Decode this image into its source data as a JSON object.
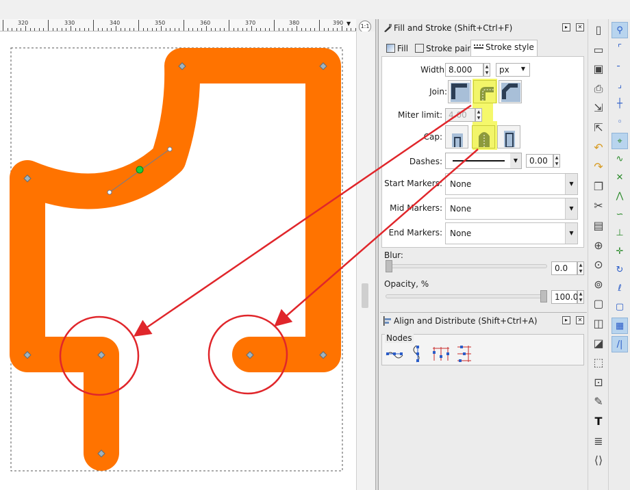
{
  "ruler": {
    "labels": [
      "320",
      "330",
      "340",
      "350",
      "360",
      "370",
      "380",
      "390"
    ],
    "arrow": "▼"
  },
  "zoom_corner": "1:1",
  "dock": {
    "fill_stroke": {
      "title": "Fill and Stroke (Shift+Ctrl+F)",
      "tabs": {
        "fill": "Fill",
        "stroke_paint": "Stroke paint",
        "stroke_style": "Stroke style"
      },
      "width_label": "Width:",
      "width_value": "8.000",
      "unit": "px",
      "join_label": "Join:",
      "join_selected": "round",
      "miter_label": "Miter limit:",
      "miter_value": "4.00",
      "cap_label": "Cap:",
      "cap_selected": "round",
      "dashes_label": "Dashes:",
      "dashes_value": "0.00",
      "start_markers_label": "Start Markers:",
      "mid_markers_label": "Mid Markers:",
      "end_markers_label": "End Markers:",
      "start_markers_value": "None",
      "mid_markers_value": "None",
      "end_markers_value": "None",
      "blur_label": "Blur:",
      "blur_value": "0.0",
      "blur_fraction": 0.0,
      "opacity_label": "Opacity, %",
      "opacity_value": "100.0",
      "opacity_fraction": 1.0
    },
    "align": {
      "title": "Align and Distribute (Shift+Ctrl+A)",
      "nodes_label": "Nodes"
    }
  },
  "colors": {
    "stroke": "#ff7300",
    "annotation": "#e0262b",
    "highlight": "#f5f86b",
    "node": "#9fb3c0",
    "selected_node": "#1fcc3a"
  },
  "command_icons": [
    "new-document-icon",
    "open-icon",
    "save-icon",
    "print-icon",
    "import-icon",
    "export-icon",
    "undo-icon",
    "redo-icon",
    "copy-icon",
    "cut-icon",
    "paste-icon",
    "zoom-selection-icon",
    "zoom-drawing-icon",
    "zoom-page-icon",
    "duplicate-icon",
    "clone-icon",
    "unlink-clone-icon",
    "group-icon",
    "ungroup-icon",
    "fill-stroke-icon",
    "text-icon",
    "layers-icon",
    "xml-editor-icon"
  ],
  "snap_icons": [
    "snap-enable-icon",
    "snap-bbox-icon",
    "snap-bbox-edge-icon",
    "snap-bbox-corner-icon",
    "snap-bbox-midpoint-icon",
    "snap-bbox-center-icon",
    "snap-nodes-icon",
    "snap-path-icon",
    "snap-intersection-icon",
    "snap-cusp-icon",
    "snap-smooth-icon",
    "snap-midpoint-icon",
    "snap-center-icon",
    "snap-rotation-icon",
    "snap-baseline-icon",
    "snap-page-icon",
    "snap-grid-icon",
    "snap-guide-icon"
  ]
}
